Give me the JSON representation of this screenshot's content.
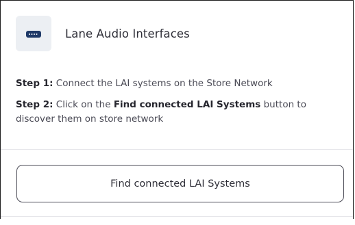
{
  "header": {
    "icon": "audio-interface-device-icon",
    "title": "Lane Audio Interfaces"
  },
  "steps": [
    {
      "label": "Step 1:",
      "text": " Connect the LAI systems on the Store Network"
    },
    {
      "label": "Step 2:",
      "text_before": " Click on the ",
      "strong": "Find connected LAI Systems",
      "text_after": " button to discover them on store network"
    }
  ],
  "action": {
    "button_label": "Find connected LAI Systems"
  },
  "colors": {
    "icon_tile_bg": "#eceff3",
    "icon_fill": "#1f3a68"
  }
}
